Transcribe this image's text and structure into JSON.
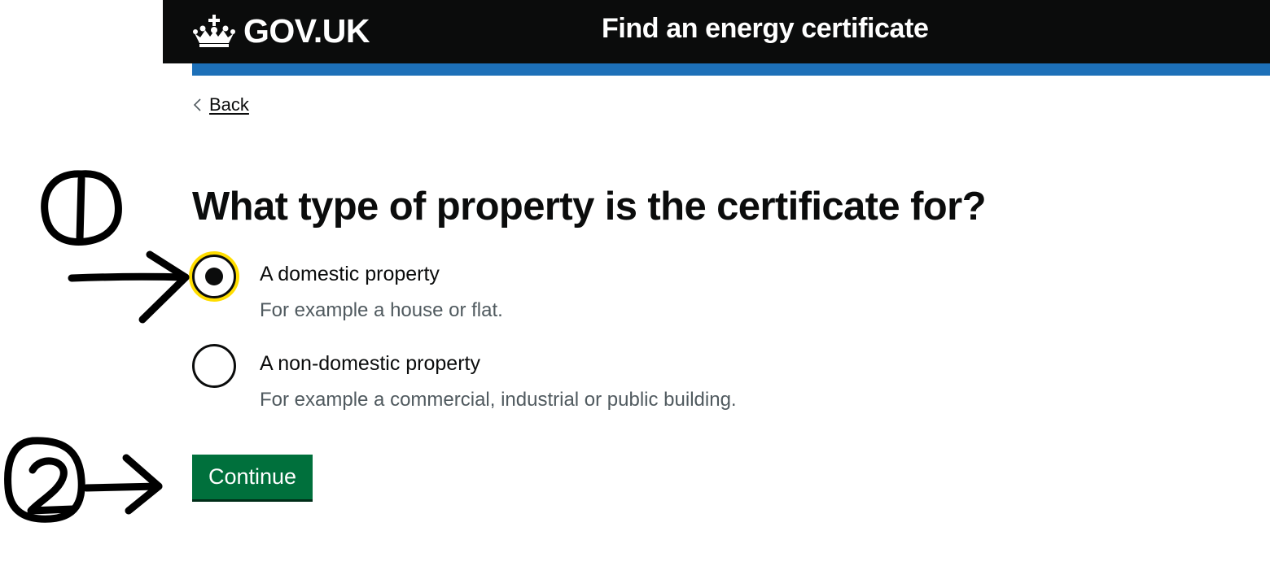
{
  "header": {
    "logo_text": "GOV.UK",
    "logo_icon": "crown-icon",
    "service_name": "Find an energy certificate"
  },
  "nav": {
    "back_label": "Back",
    "back_icon": "chevron-left-icon"
  },
  "form": {
    "question": "What type of property is the certificate for?",
    "options": [
      {
        "label": "A domestic property",
        "hint": "For example a house or flat.",
        "selected": true
      },
      {
        "label": "A non-domestic property",
        "hint": "For example a commercial, industrial or public building.",
        "selected": false
      }
    ],
    "continue_label": "Continue"
  },
  "colors": {
    "header_bg": "#0b0c0c",
    "header_accent": "#1d70b8",
    "focus": "#ffdd00",
    "button": "#00703c",
    "hint_text": "#505a5f"
  },
  "annotations": {
    "marker_1_icon": "circled-number-1-icon",
    "marker_2_icon": "circled-number-2-icon",
    "arrow_icon": "hand-drawn-arrow-icon"
  }
}
